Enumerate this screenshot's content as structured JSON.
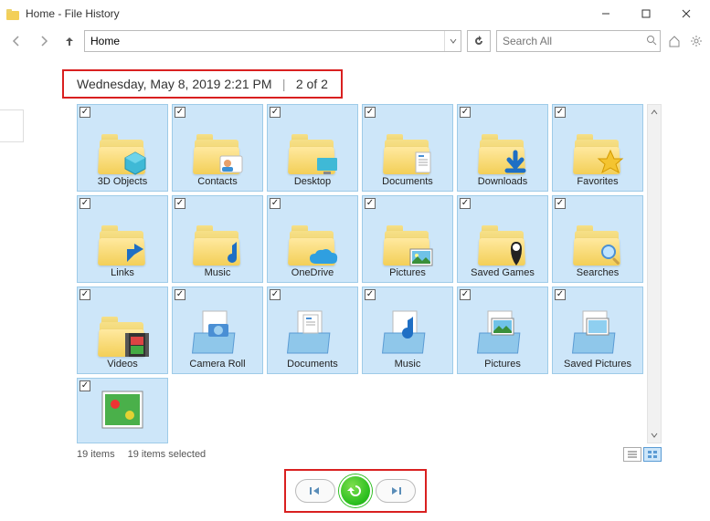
{
  "window": {
    "title": "Home - File History"
  },
  "nav": {
    "address_value": "Home",
    "search_placeholder": "Search All"
  },
  "highlight": {
    "timestamp": "Wednesday, May 8, 2019 2:21 PM",
    "position": "2 of 2"
  },
  "items": [
    {
      "label": "3D Objects",
      "checked": true,
      "icon": "folder-3dobjects"
    },
    {
      "label": "Contacts",
      "checked": true,
      "icon": "folder-contacts"
    },
    {
      "label": "Desktop",
      "checked": true,
      "icon": "folder-desktop"
    },
    {
      "label": "Documents",
      "checked": true,
      "icon": "folder-documents"
    },
    {
      "label": "Downloads",
      "checked": true,
      "icon": "folder-downloads"
    },
    {
      "label": "Favorites",
      "checked": true,
      "icon": "folder-favorites"
    },
    {
      "label": "Links",
      "checked": true,
      "icon": "folder-links"
    },
    {
      "label": "Music",
      "checked": true,
      "icon": "folder-music"
    },
    {
      "label": "OneDrive",
      "checked": true,
      "icon": "folder-onedrive"
    },
    {
      "label": "Pictures",
      "checked": true,
      "icon": "folder-pictures"
    },
    {
      "label": "Saved Games",
      "checked": true,
      "icon": "folder-savedgames"
    },
    {
      "label": "Searches",
      "checked": true,
      "icon": "folder-searches"
    },
    {
      "label": "Videos",
      "checked": true,
      "icon": "folder-videos"
    },
    {
      "label": "Camera Roll",
      "checked": true,
      "icon": "library-camera"
    },
    {
      "label": "Documents",
      "checked": true,
      "icon": "library-documents"
    },
    {
      "label": "Music",
      "checked": true,
      "icon": "library-music"
    },
    {
      "label": "Pictures",
      "checked": true,
      "icon": "library-pictures"
    },
    {
      "label": "Saved Pictures",
      "checked": true,
      "icon": "library-savedpictures"
    }
  ],
  "extra_tile": {
    "checked": true,
    "icon": "picture-thumb"
  },
  "status": {
    "count_text": "19 items",
    "selected_text": "19 items selected"
  },
  "controls": {
    "prev": "previous-version",
    "restore": "restore",
    "next": "next-version"
  }
}
